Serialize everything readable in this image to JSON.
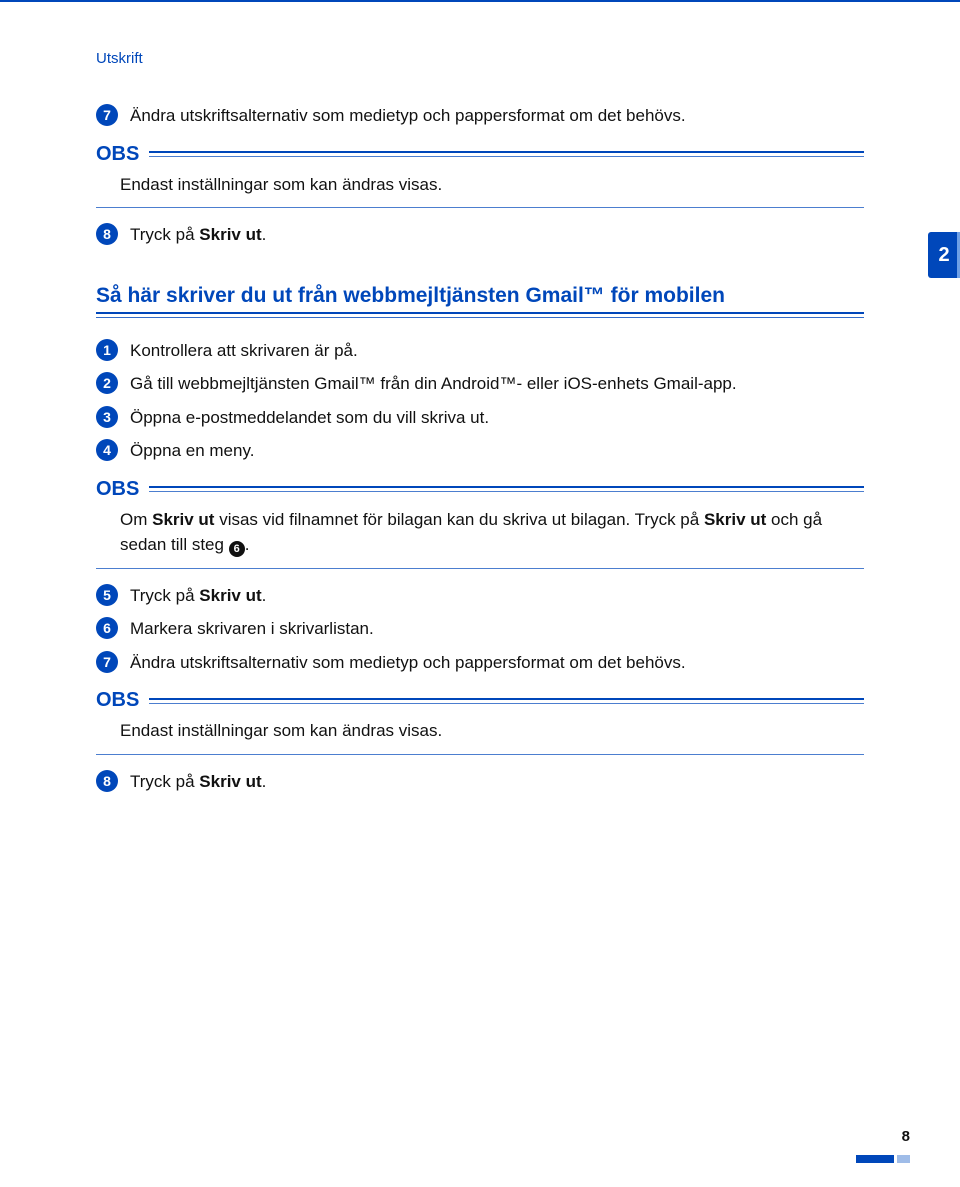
{
  "section_tag": "Utskrift",
  "side_tab": "2",
  "page_number": "8",
  "obs_label": "OBS",
  "pre_steps": [
    {
      "num": "7",
      "text": "Ändra utskriftsalternativ som medietyp och pappersformat om det behövs."
    },
    {
      "num": "8",
      "pre": "Tryck på ",
      "bold": "Skriv ut",
      "post": "."
    }
  ],
  "pre_obs": {
    "body": "Endast inställningar som kan ändras visas."
  },
  "heading": "Så här skriver du ut från webbmejltjänsten Gmail™ för mobilen",
  "steps": [
    {
      "num": "1",
      "text": "Kontrollera att skrivaren är på."
    },
    {
      "num": "2",
      "text": "Gå till webbmejltjänsten Gmail™ från din Android™- eller iOS-enhets Gmail-app."
    },
    {
      "num": "3",
      "text": "Öppna e-postmeddelandet som du vill skriva ut."
    },
    {
      "num": "4",
      "text": "Öppna en meny."
    },
    {
      "num": "5",
      "pre": "Tryck på ",
      "bold": "Skriv ut",
      "post": "."
    },
    {
      "num": "6",
      "text": "Markera skrivaren i skrivarlistan."
    },
    {
      "num": "7",
      "text": "Ändra utskriftsalternativ som medietyp och pappersformat om det behövs."
    },
    {
      "num": "8",
      "pre": "Tryck på ",
      "bold": "Skriv ut",
      "post": "."
    }
  ],
  "mid_obs": {
    "pre": "Om ",
    "bold1": "Skriv ut",
    "mid": " visas vid filnamnet för bilagan kan du skriva ut bilagan. Tryck på ",
    "bold2": "Skriv ut",
    "post1": " och gå sedan till steg ",
    "ref": "6",
    "post2": "."
  },
  "post_obs": {
    "body": "Endast inställningar som kan ändras visas."
  }
}
